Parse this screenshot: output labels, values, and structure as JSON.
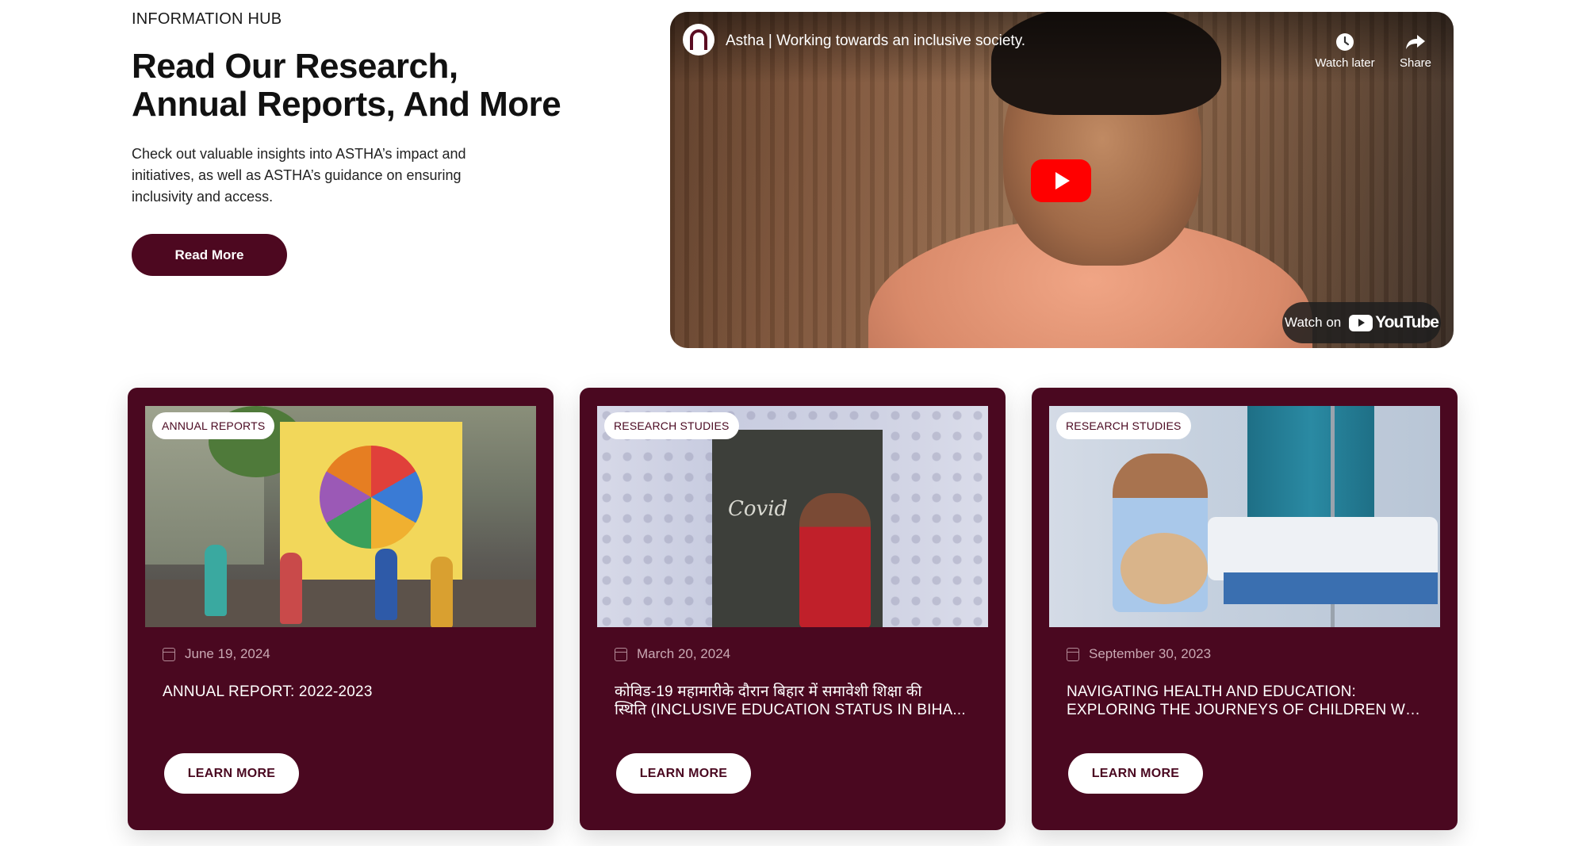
{
  "hero": {
    "eyebrow": "INFORMATION HUB",
    "title": "Read Our Research, Annual Reports, And More",
    "description": "Check out valuable insights into ASTHA’s impact and initiatives, as well as ASTHA’s guidance on ensuring inclusivity and access.",
    "cta_label": "Read More"
  },
  "video": {
    "title": "Astha | Working towards an inclusive society.",
    "watch_later_label": "Watch later",
    "share_label": "Share",
    "watch_on_label": "Watch on",
    "youtube_word": "YouTube"
  },
  "cards": [
    {
      "badge": "ANNUAL REPORTS",
      "date": "June 19, 2024",
      "title_line1": "ANNUAL REPORT: 2022-2023",
      "title_line2": "",
      "cta_label": "LEARN MORE"
    },
    {
      "badge": "RESEARCH STUDIES",
      "date": "March 20, 2024",
      "title_line1": "कोविड-19 महामारीके दौरान बिहार में समावेशी शिक्षा की",
      "title_line2": "स्थिति (INCLUSIVE EDUCATION STATUS IN BIHA...",
      "cta_label": "LEARN MORE"
    },
    {
      "badge": "RESEARCH STUDIES",
      "date": "September 30, 2023",
      "title_line1": "NAVIGATING HEALTH AND EDUCATION:",
      "title_line2": "EXPLORING THE JOURNEYS OF CHILDREN WIT...",
      "cta_label": "LEARN MORE"
    }
  ],
  "image_text": {
    "board_word": "Covid"
  },
  "colors": {
    "brand": "#4a0820",
    "youtube_red": "#ff0000"
  }
}
